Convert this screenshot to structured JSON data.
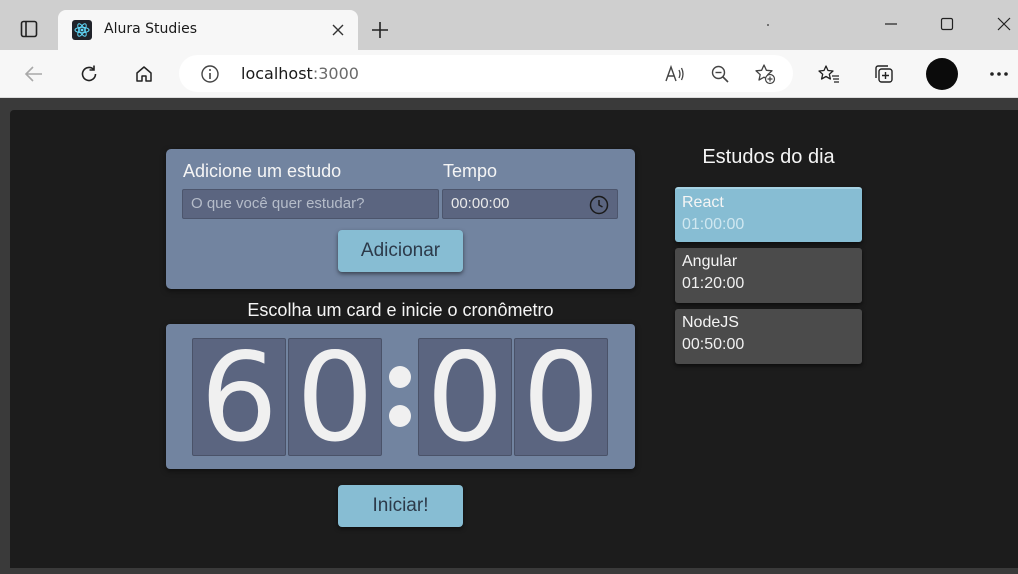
{
  "browser": {
    "tab_title": "Alura Studies",
    "url_host": "localhost",
    "url_port": ":3000"
  },
  "form": {
    "study_label": "Adicione um estudo",
    "study_placeholder": "O que você quer estudar?",
    "time_label": "Tempo",
    "time_value": "00:00:00",
    "add_button": "Adicionar"
  },
  "timer": {
    "caption": "Escolha um card e inicie o cronômetro",
    "digits": [
      "6",
      "0",
      "0",
      "0"
    ],
    "start_button": "Iniciar!"
  },
  "studies": {
    "title": "Estudos do dia",
    "items": [
      {
        "name": "React",
        "time": "01:00:00",
        "selected": true
      },
      {
        "name": "Angular",
        "time": "01:20:00",
        "selected": false
      },
      {
        "name": "NodeJS",
        "time": "00:50:00",
        "selected": false
      }
    ]
  },
  "colors": {
    "panel": "#7284a0",
    "button": "#87bdd3",
    "card": "#4b4b4b",
    "background": "#1c1c1c"
  }
}
